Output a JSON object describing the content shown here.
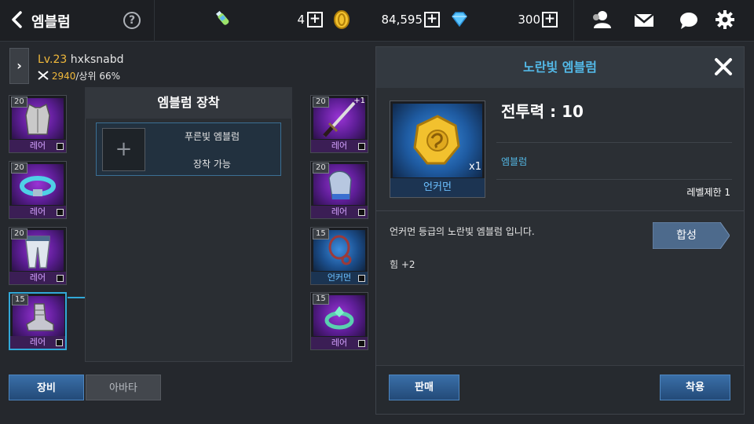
{
  "header": {
    "title": "엠블럼",
    "help": "?",
    "currencies": [
      {
        "icon": "energy-drink-icon",
        "value": "4"
      },
      {
        "icon": "gold-coin-icon",
        "value": "84,595"
      },
      {
        "icon": "diamond-gem-icon",
        "value": "300"
      }
    ],
    "plus": "+",
    "right_icons": [
      "friends-icon",
      "mail-icon",
      "chat-icon",
      "settings-gear-icon"
    ]
  },
  "profile": {
    "expand": "›",
    "level": "Lv.23",
    "name": "hxksnabd",
    "power_value": "2940",
    "rank": "/상위 66%"
  },
  "left_slots": [
    {
      "level": "20",
      "grade": "레어",
      "item": "armor-vest"
    },
    {
      "level": "20",
      "grade": "레어",
      "item": "belt"
    },
    {
      "level": "20",
      "grade": "레어",
      "item": "pants"
    },
    {
      "level": "15",
      "grade": "레어",
      "item": "boots",
      "selected": true
    }
  ],
  "right_slots": [
    {
      "level": "20",
      "grade": "레어",
      "item": "sword",
      "enhance": "+1"
    },
    {
      "level": "20",
      "grade": "레어",
      "item": "gauntlet"
    },
    {
      "level": "15",
      "grade": "언커먼",
      "item": "necklace"
    },
    {
      "level": "15",
      "grade": "레어",
      "item": "ring"
    }
  ],
  "equip_panel": {
    "title": "엠블럼 장착",
    "slot_name": "푸른빛 엠블럼",
    "slot_status": "장착 가능",
    "add": "+"
  },
  "tabs": {
    "equipment": "장비",
    "avatar": "아바타"
  },
  "detail": {
    "title": "노란빛 엠블럼",
    "close": "✕",
    "item_grade": "언커먼",
    "quantity": "x1",
    "combat_power": "전투력 : 10",
    "type": "엠블럼",
    "level_limit": "레벨제한 1",
    "description": "언커먼 등급의 노란빛 엠블럼 입니다.",
    "stat": "힘 +2",
    "synthesize": "합성",
    "sell": "판매",
    "equip": "착용"
  },
  "colors": {
    "accent_blue": "#53b8e6",
    "rare_purple": "#d4a2ff",
    "uncommon_blue": "#6cc0ff",
    "gold": "#f1b93b",
    "button_blue": "#2f5f96"
  }
}
